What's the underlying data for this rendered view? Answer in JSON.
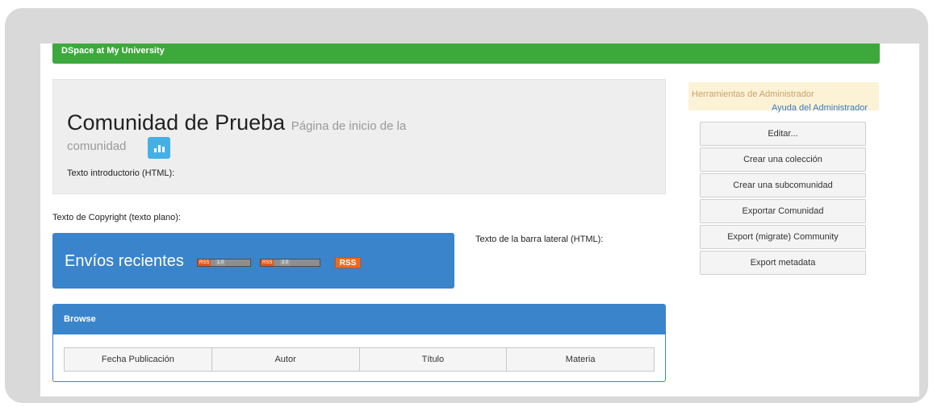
{
  "header": {
    "site_title": "DSpace at My University"
  },
  "community": {
    "name": "Comunidad de Prueba",
    "subtitle_line1": "Página de inicio de la",
    "subtitle_line2": "comunidad",
    "intro_text": "Texto introductorio (HTML):",
    "copyright_text": "Texto de Copyright (texto plano):",
    "sidebar_text": "Texto de la barra lateral (HTML):"
  },
  "recent": {
    "title": "Envíos recientes",
    "feeds": [
      {
        "a": "RSS",
        "b": "1.0"
      },
      {
        "a": "RSS",
        "b": "2.0"
      }
    ],
    "rss_label": "RSS"
  },
  "browse": {
    "title": "Browse",
    "buttons": [
      "Fecha Publicación",
      "Autor",
      "Título",
      "Materia"
    ]
  },
  "admin": {
    "title": "Herramientas de Administrador",
    "help_link": "Ayuda del Administrador",
    "buttons": [
      "Editar...",
      "Crear una colección",
      "Crear una subcomunidad",
      "Exportar Comunidad",
      "Export (migrate) Community",
      "Export metadata"
    ]
  },
  "colors": {
    "header_green": "#3da93c",
    "panel_blue": "#3a84cc",
    "stats_blue": "#45b0e6",
    "admin_bg": "#fcf2d6",
    "rss_orange": "#ef6a1e"
  },
  "icons": {
    "stats": "bar-chart-icon"
  }
}
